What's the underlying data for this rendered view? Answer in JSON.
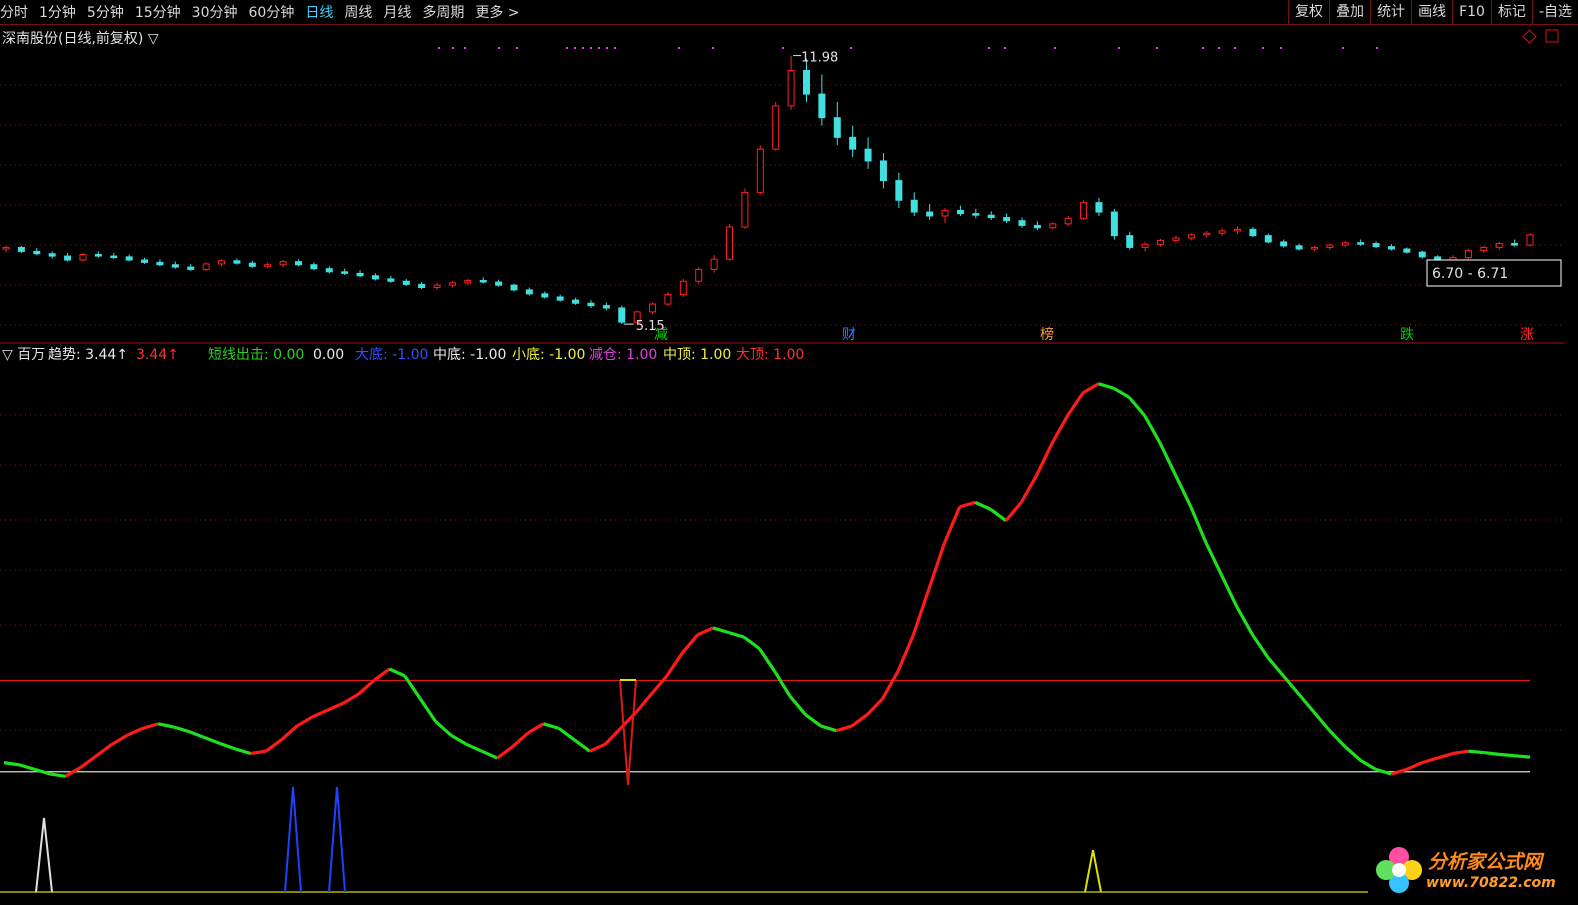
{
  "toolbar": {
    "periods": [
      {
        "label": "分时"
      },
      {
        "label": "1分钟"
      },
      {
        "label": "5分钟"
      },
      {
        "label": "15分钟"
      },
      {
        "label": "30分钟"
      },
      {
        "label": "60分钟"
      },
      {
        "label": "日线",
        "active": true
      },
      {
        "label": "周线"
      },
      {
        "label": "月线"
      },
      {
        "label": "多周期"
      },
      {
        "label": "更多 >"
      }
    ],
    "tools": [
      {
        "label": "复权"
      },
      {
        "label": "叠加"
      },
      {
        "label": "统计"
      },
      {
        "label": "画线"
      },
      {
        "label": "F10"
      },
      {
        "label": "标记"
      },
      {
        "label": "-自选"
      }
    ]
  },
  "main_panel": {
    "title": "深南股份(日线,前复权) ▽",
    "high_label": "11.98",
    "low_label": "5.15",
    "range_label": "6.70 - 6.71",
    "events": [
      {
        "label": "减",
        "color": "#00cc00"
      },
      {
        "label": "财",
        "color": "#3a7bff"
      },
      {
        "label": "榜",
        "color": "#ff9a3a"
      },
      {
        "label": "跌",
        "color": "#00cc00"
      },
      {
        "label": "涨",
        "color": "#ff2a2a"
      }
    ]
  },
  "indicator_panel": {
    "title": "▽ 百万",
    "legend": [
      {
        "label": "趋势: 3.44↑",
        "color": "#e8e8e8"
      },
      {
        "label": "3.44↑",
        "color": "#ff3030"
      },
      {
        "label": "短线出击: 0.00",
        "color": "#28d028"
      },
      {
        "label": "0.00",
        "color": "#e8e8e8"
      },
      {
        "label": "大底: -1.00",
        "color": "#3050ff"
      },
      {
        "label": "中底: -1.00",
        "color": "#e8e8e8"
      },
      {
        "label": "小底: -1.00",
        "color": "#f0f040"
      },
      {
        "label": "减仓: 1.00",
        "color": "#e040e0"
      },
      {
        "label": "中顶: 1.00",
        "color": "#f0f040"
      },
      {
        "label": "大顶: 1.00",
        "color": "#ff3030"
      }
    ]
  },
  "watermark": {
    "brand": "分析家公式网",
    "url": "www.70822.com"
  },
  "colors": {
    "up": "#ff2020",
    "down": "#40e0e0",
    "trend_up": "#ff1a1a",
    "trend_down": "#1ee01e",
    "grid": "#8a1010"
  },
  "chart_data": [
    {
      "type": "candlestick",
      "title": "深南股份(日线,前复权)",
      "annotations": {
        "high": 11.98,
        "low": 5.15,
        "range": "6.70 - 6.71"
      },
      "ohlc": [
        [
          7.06,
          7.14,
          6.98,
          7.1
        ],
        [
          7.1,
          7.14,
          6.96,
          7.0
        ],
        [
          7.0,
          7.08,
          6.9,
          6.94
        ],
        [
          6.94,
          7.0,
          6.82,
          6.88
        ],
        [
          6.88,
          6.96,
          6.74,
          6.78
        ],
        [
          6.78,
          6.96,
          6.74,
          6.92
        ],
        [
          6.92,
          7.0,
          6.84,
          6.88
        ],
        [
          6.88,
          6.96,
          6.8,
          6.86
        ],
        [
          6.86,
          6.92,
          6.74,
          6.78
        ],
        [
          6.78,
          6.84,
          6.68,
          6.72
        ],
        [
          6.72,
          6.8,
          6.62,
          6.66
        ],
        [
          6.66,
          6.74,
          6.56,
          6.6
        ],
        [
          6.6,
          6.68,
          6.5,
          6.54
        ],
        [
          6.54,
          6.72,
          6.5,
          6.68
        ],
        [
          6.68,
          6.8,
          6.62,
          6.76
        ],
        [
          6.76,
          6.82,
          6.66,
          6.7
        ],
        [
          6.7,
          6.76,
          6.58,
          6.62
        ],
        [
          6.62,
          6.72,
          6.56,
          6.66
        ],
        [
          6.66,
          6.78,
          6.6,
          6.74
        ],
        [
          6.74,
          6.8,
          6.62,
          6.66
        ],
        [
          6.66,
          6.72,
          6.52,
          6.56
        ],
        [
          6.56,
          6.62,
          6.44,
          6.48
        ],
        [
          6.48,
          6.56,
          6.4,
          6.44
        ],
        [
          6.44,
          6.52,
          6.34,
          6.38
        ],
        [
          6.38,
          6.44,
          6.26,
          6.3
        ],
        [
          6.3,
          6.38,
          6.2,
          6.24
        ],
        [
          6.24,
          6.3,
          6.12,
          6.16
        ],
        [
          6.16,
          6.22,
          6.04,
          6.08
        ],
        [
          6.08,
          6.2,
          6.02,
          6.14
        ],
        [
          6.14,
          6.24,
          6.08,
          6.2
        ],
        [
          6.2,
          6.3,
          6.14,
          6.26
        ],
        [
          6.26,
          6.34,
          6.18,
          6.22
        ],
        [
          6.22,
          6.28,
          6.1,
          6.14
        ],
        [
          6.14,
          6.18,
          5.98,
          6.02
        ],
        [
          6.02,
          6.08,
          5.88,
          5.92
        ],
        [
          5.92,
          5.98,
          5.8,
          5.84
        ],
        [
          5.84,
          5.9,
          5.72,
          5.76
        ],
        [
          5.76,
          5.82,
          5.64,
          5.68
        ],
        [
          5.68,
          5.76,
          5.56,
          5.62
        ],
        [
          5.62,
          5.7,
          5.5,
          5.56
        ],
        [
          5.56,
          5.62,
          5.15,
          5.2
        ],
        [
          5.2,
          5.5,
          5.15,
          5.46
        ],
        [
          5.46,
          5.7,
          5.4,
          5.66
        ],
        [
          5.66,
          5.96,
          5.6,
          5.9
        ],
        [
          5.9,
          6.3,
          5.84,
          6.24
        ],
        [
          6.24,
          6.6,
          6.16,
          6.54
        ],
        [
          6.54,
          6.9,
          6.46,
          6.8
        ],
        [
          6.8,
          7.7,
          6.76,
          7.62
        ],
        [
          7.62,
          8.6,
          7.58,
          8.5
        ],
        [
          8.5,
          9.7,
          8.44,
          9.6
        ],
        [
          9.6,
          10.8,
          9.56,
          10.7
        ],
        [
          10.7,
          11.98,
          10.6,
          11.6
        ],
        [
          11.6,
          11.9,
          10.8,
          11.0
        ],
        [
          11.0,
          11.5,
          10.2,
          10.4
        ],
        [
          10.4,
          10.8,
          9.7,
          9.9
        ],
        [
          9.9,
          10.2,
          9.4,
          9.6
        ],
        [
          9.6,
          9.9,
          9.1,
          9.3
        ],
        [
          9.3,
          9.5,
          8.6,
          8.8
        ],
        [
          8.8,
          9.0,
          8.1,
          8.3
        ],
        [
          8.3,
          8.5,
          7.9,
          8.0
        ],
        [
          8.0,
          8.2,
          7.8,
          7.9
        ],
        [
          7.9,
          8.1,
          7.72,
          8.04
        ],
        [
          8.04,
          8.16,
          7.9,
          7.96
        ],
        [
          7.96,
          8.08,
          7.84,
          7.92
        ],
        [
          7.92,
          8.02,
          7.8,
          7.86
        ],
        [
          7.86,
          7.96,
          7.72,
          7.78
        ],
        [
          7.78,
          7.86,
          7.6,
          7.66
        ],
        [
          7.66,
          7.76,
          7.54,
          7.6
        ],
        [
          7.6,
          7.74,
          7.56,
          7.7
        ],
        [
          7.7,
          7.9,
          7.64,
          7.84
        ],
        [
          7.84,
          8.3,
          7.8,
          8.24
        ],
        [
          8.24,
          8.36,
          7.9,
          8.0
        ],
        [
          8.0,
          8.08,
          7.3,
          7.4
        ],
        [
          7.4,
          7.5,
          7.04,
          7.1
        ],
        [
          7.1,
          7.24,
          7.0,
          7.18
        ],
        [
          7.18,
          7.32,
          7.12,
          7.28
        ],
        [
          7.28,
          7.4,
          7.22,
          7.34
        ],
        [
          7.34,
          7.46,
          7.28,
          7.42
        ],
        [
          7.42,
          7.52,
          7.34,
          7.46
        ],
        [
          7.46,
          7.58,
          7.4,
          7.52
        ],
        [
          7.52,
          7.64,
          7.44,
          7.56
        ],
        [
          7.56,
          7.62,
          7.36,
          7.4
        ],
        [
          7.4,
          7.46,
          7.2,
          7.24
        ],
        [
          7.24,
          7.3,
          7.1,
          7.14
        ],
        [
          7.14,
          7.2,
          7.02,
          7.06
        ],
        [
          7.06,
          7.14,
          7.0,
          7.1
        ],
        [
          7.1,
          7.2,
          7.04,
          7.16
        ],
        [
          7.16,
          7.26,
          7.1,
          7.22
        ],
        [
          7.22,
          7.3,
          7.14,
          7.2
        ],
        [
          7.2,
          7.26,
          7.08,
          7.12
        ],
        [
          7.12,
          7.18,
          7.02,
          7.06
        ],
        [
          7.06,
          7.1,
          6.94,
          6.98
        ],
        [
          6.98,
          7.02,
          6.82,
          6.86
        ],
        [
          6.86,
          6.9,
          6.4,
          6.46
        ],
        [
          6.46,
          6.9,
          6.38,
          6.84
        ],
        [
          6.84,
          7.06,
          6.8,
          7.02
        ],
        [
          7.02,
          7.14,
          6.96,
          7.1
        ],
        [
          7.1,
          7.24,
          7.04,
          7.2
        ],
        [
          7.2,
          7.3,
          7.12,
          7.16
        ],
        [
          7.16,
          7.46,
          7.12,
          7.42
        ]
      ]
    },
    {
      "type": "line",
      "title": "百万",
      "series": [
        {
          "name": "趋势",
          "values": [
            0.2,
            0.15,
            0.05,
            -0.05,
            -0.1,
            0.1,
            0.35,
            0.6,
            0.8,
            0.95,
            1.05,
            0.98,
            0.88,
            0.75,
            0.62,
            0.5,
            0.4,
            0.45,
            0.7,
            1.0,
            1.2,
            1.35,
            1.5,
            1.7,
            2.0,
            2.25,
            2.1,
            1.6,
            1.1,
            0.8,
            0.6,
            0.45,
            0.3,
            0.55,
            0.85,
            1.05,
            0.95,
            0.7,
            0.45,
            0.6,
            0.95,
            1.3,
            1.7,
            2.1,
            2.6,
            3.0,
            3.15,
            3.05,
            2.95,
            2.7,
            2.2,
            1.65,
            1.25,
            1.0,
            0.9,
            1.0,
            1.25,
            1.6,
            2.2,
            3.0,
            4.0,
            5.0,
            5.8,
            5.9,
            5.75,
            5.5,
            5.9,
            6.5,
            7.2,
            7.8,
            8.3,
            8.5,
            8.4,
            8.2,
            7.8,
            7.2,
            6.5,
            5.8,
            5.0,
            4.3,
            3.6,
            3.0,
            2.5,
            2.1,
            1.7,
            1.3,
            0.9,
            0.55,
            0.25,
            0.05,
            -0.05,
            0.05,
            0.2,
            0.3,
            0.4,
            0.45,
            0.42,
            0.38,
            0.35,
            0.32
          ]
        }
      ],
      "reference_lines": [
        2.0,
        0.0
      ]
    }
  ]
}
